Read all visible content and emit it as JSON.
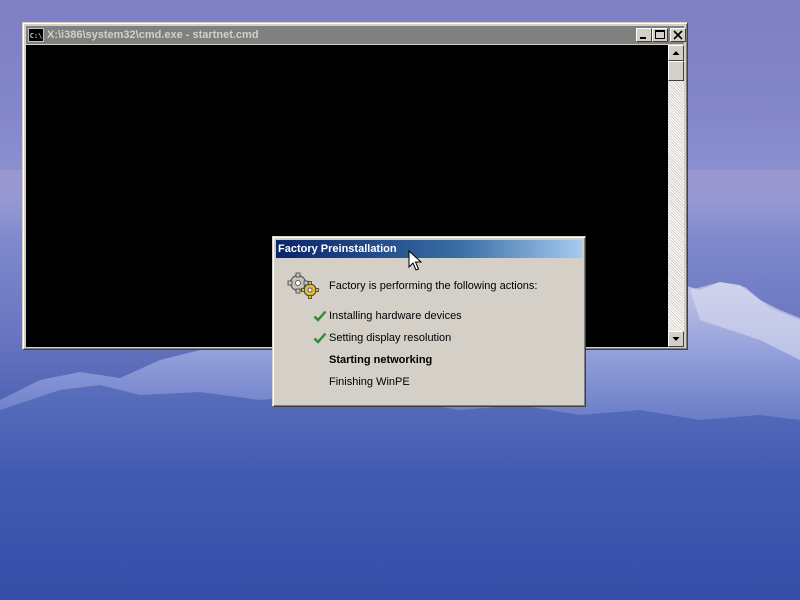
{
  "cmd_window": {
    "title": "X:\\i386\\system32\\cmd.exe - startnet.cmd",
    "icon_text": "C:\\",
    "icon": "console-icon",
    "buttons": {
      "minimize": "minimize-icon",
      "maximize": "maximize-icon",
      "close": "close-icon"
    }
  },
  "factory_dialog": {
    "title": "Factory Preinstallation",
    "icon": "gears-icon",
    "intro": "Factory is performing the following actions:",
    "steps": [
      {
        "label": "Installing hardware devices",
        "status": "done"
      },
      {
        "label": "Setting display resolution",
        "status": "done"
      },
      {
        "label": "Starting networking",
        "status": "in-progress"
      },
      {
        "label": "Finishing WinPE",
        "status": "pending"
      }
    ]
  },
  "colors": {
    "active_title_start": "#0a246a",
    "active_title_end": "#a6caf0",
    "inactive_title": "#808080",
    "check_green": "#2e8b2e",
    "window_face": "#d4d0c8"
  }
}
